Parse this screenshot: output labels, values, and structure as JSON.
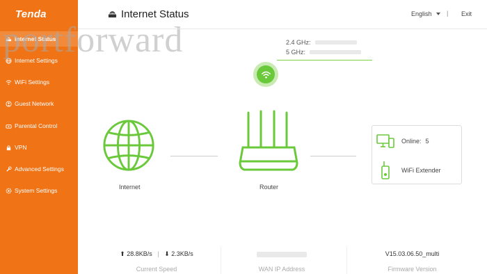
{
  "app": {
    "brand": "Tenda",
    "watermark": "portforward"
  },
  "sidebar": {
    "items": [
      {
        "label": "Internet Status",
        "icon": "router-icon",
        "active": true
      },
      {
        "label": "Internet Settings",
        "icon": "globe-icon"
      },
      {
        "label": "WiFi Settings",
        "icon": "wifi-icon"
      },
      {
        "label": "Guest Network",
        "icon": "guest-icon"
      },
      {
        "label": "Parental Control",
        "icon": "parental-icon"
      },
      {
        "label": "VPN",
        "icon": "vpn-icon"
      },
      {
        "label": "Advanced Settings",
        "icon": "wrench-icon"
      },
      {
        "label": "System Settings",
        "icon": "gear-icon"
      }
    ]
  },
  "header": {
    "title": "Internet Status",
    "language": "English",
    "separator": "|",
    "exit": "Exit"
  },
  "wifi": {
    "band24_label": "2.4 GHz:",
    "band5_label": "5 GHz:"
  },
  "diagram": {
    "internet_label": "Internet",
    "router_label": "Router",
    "online_label": "Online:",
    "online_count": "5",
    "extender_label": "WiFi Extender"
  },
  "stats": {
    "upload": "28.8KB/s",
    "download": "2.3KB/s",
    "speed_separator": "|",
    "current_speed_label": "Current Speed",
    "wan_label": "WAN IP Address",
    "firmware": "V15.03.06.50_multi",
    "firmware_label": "Firmware Version"
  },
  "colors": {
    "sidebar": "#f07316",
    "accent_green": "#6ac93a"
  }
}
